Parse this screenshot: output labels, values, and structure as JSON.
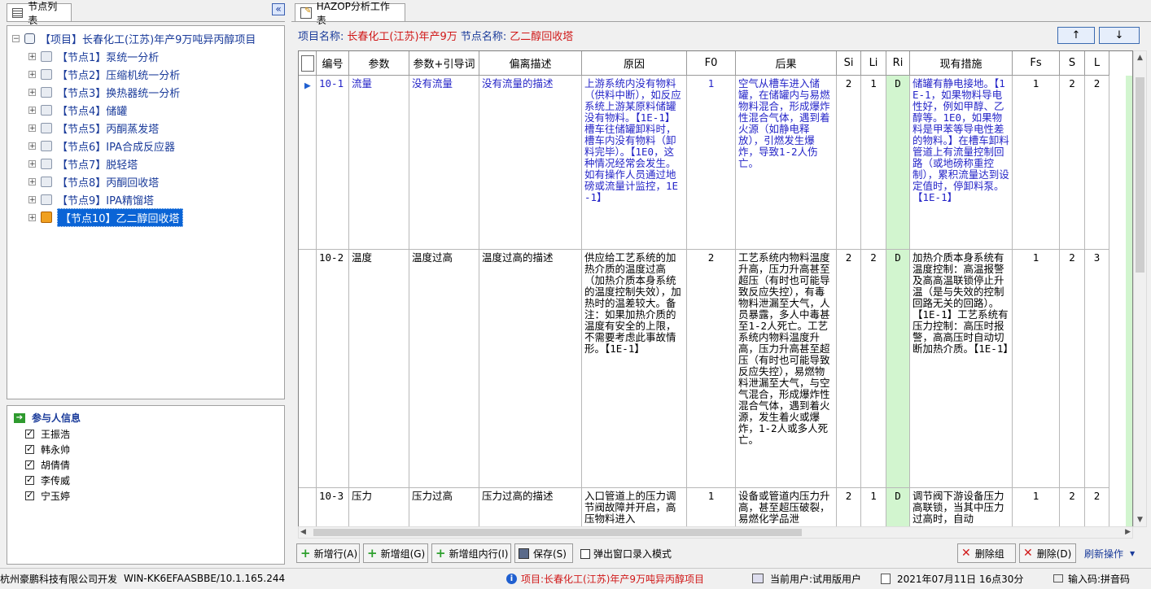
{
  "left_panel": {
    "tab_title": "节点列表",
    "collapse_label": "«"
  },
  "tree": {
    "root_label": "【项目】长春化工(江苏)年产9万吨异丙醇项目",
    "nodes": [
      {
        "label": "【节点1】泵统一分析"
      },
      {
        "label": "【节点2】压缩机统一分析"
      },
      {
        "label": "【节点3】换热器统一分析"
      },
      {
        "label": "【节点4】储罐"
      },
      {
        "label": "【节点5】丙酮蒸发塔"
      },
      {
        "label": "【节点6】IPA合成反应器"
      },
      {
        "label": "【节点7】脱轻塔"
      },
      {
        "label": "【节点8】丙酮回收塔"
      },
      {
        "label": "【节点9】IPA精馏塔"
      },
      {
        "label": "【节点10】乙二醇回收塔"
      }
    ]
  },
  "participants": {
    "title": "参与人信息",
    "people": [
      "王振浩",
      "韩永帅",
      "胡倩倩",
      "李传威",
      "宁玉婷"
    ]
  },
  "main": {
    "tab_title": "HAZOP分析工作表",
    "project_label": "项目名称:",
    "project_value": "长春化工(江苏)年产9万",
    "node_label": "节点名称:",
    "node_value": "乙二醇回收塔",
    "up_button": "↑",
    "down_button": "↓"
  },
  "table": {
    "headers": [
      "编号",
      "参数",
      "参数+引导词",
      "偏离描述",
      "原因",
      "F0",
      "后果",
      "Si",
      "Li",
      "Ri",
      "现有措施",
      "Fs",
      "S",
      "L"
    ],
    "rows": [
      {
        "id": "10-1",
        "param": "流量",
        "guide": "没有流量",
        "deviation": "没有流量的描述",
        "cause": "上游系统内没有物料（供料中断），如反应系统上游某原料储罐没有物料。【1E-1】槽车往储罐卸料时，槽车内没有物料（卸料完毕）。【1E0，这种情况经常会发生。如有操作人员通过地磅或流量计监控，1E-1】",
        "f0": "1",
        "consequence": "空气从槽车进入储罐，在储罐内与易燃物料混合，形成爆炸性混合气体，遇到着火源（如静电释放），引燃发生爆炸，导致1-2人伤亡。",
        "si": "2",
        "li": "1",
        "ri": "D",
        "measures": "储罐有静电接地。【1E-1，如果物料导电性好，例如甲醇、乙醇等。1E0，如果物料是甲苯等导电性差的物料。】在槽车卸料管道上有流量控制回路（或地磅称重控制），累积流量达到设定值时，停卸料泵。【1E-1】",
        "fs": "1",
        "s": "2",
        "l": "2"
      },
      {
        "id": "10-2",
        "param": "温度",
        "guide": "温度过高",
        "deviation": "温度过高的描述",
        "cause": "供应给工艺系统的加热介质的温度过高（加热介质本身系统的温度控制失效），加热时的温差较大。备注：如果加热介质的温度有安全的上限，不需要考虑此事故情形。【1E-1】",
        "f0": "2",
        "consequence": "工艺系统内物料温度升高，压力升高甚至超压（有时也可能导致反应失控），有毒物料泄漏至大气，人员暴露，多人中毒甚至1-2人死亡。工艺系统内物料温度升高，压力升高甚至超压（有时也可能导致反应失控），易燃物料泄漏至大气，与空气混合，形成爆炸性混合气体，遇到着火源，发生着火或爆炸，1-2人或多人死亡。",
        "si": "2",
        "li": "2",
        "ri": "D",
        "measures": "加热介质本身系统有温度控制：高温报警及高高温联锁停止升温（是与失效的控制回路无关的回路）。【1E-1】工艺系统有压力控制：高压时报警，高高压时自动切断加热介质。【1E-1】",
        "fs": "1",
        "s": "2",
        "l": "3"
      },
      {
        "id": "10-3",
        "param": "压力",
        "guide": "压力过高",
        "deviation": "压力过高的描述",
        "cause": "入口管道上的压力调节阀故障并开启，高压物料进入",
        "f0": "1",
        "consequence": "设备或管道内压力升高，甚至超压破裂，易燃化学品泄",
        "si": "2",
        "li": "1",
        "ri": "D",
        "measures": "调节阀下游设备压力高联锁，当其中压力过高时，自动",
        "fs": "1",
        "s": "2",
        "l": "2"
      }
    ]
  },
  "toolbar": {
    "add_row": "新增行(A)",
    "add_group": "新增组(G)",
    "add_in_group": "新增组内行(I)",
    "save": "保存(S)",
    "popup_mode": "弹出窗口录入模式",
    "delete_group": "删除组",
    "delete": "删除(D)",
    "refresh": "刷新操作"
  },
  "status": {
    "company": "杭州豪鹏科技有限公司开发",
    "host": "WIN-KK6EFAASBBE/10.1.165.244",
    "project": "项目:长春化工(江苏)年产9万吨异丙醇项目",
    "user": "当前用户:试用版用户",
    "datetime": "2021年07月11日 16点30分",
    "input": "输入码:拼音码"
  },
  "colors": {
    "accent_blue": "#1a3b9a",
    "red_text": "#d01818",
    "ri_green": "#d2f5cf",
    "selection": "#0a64d6"
  }
}
